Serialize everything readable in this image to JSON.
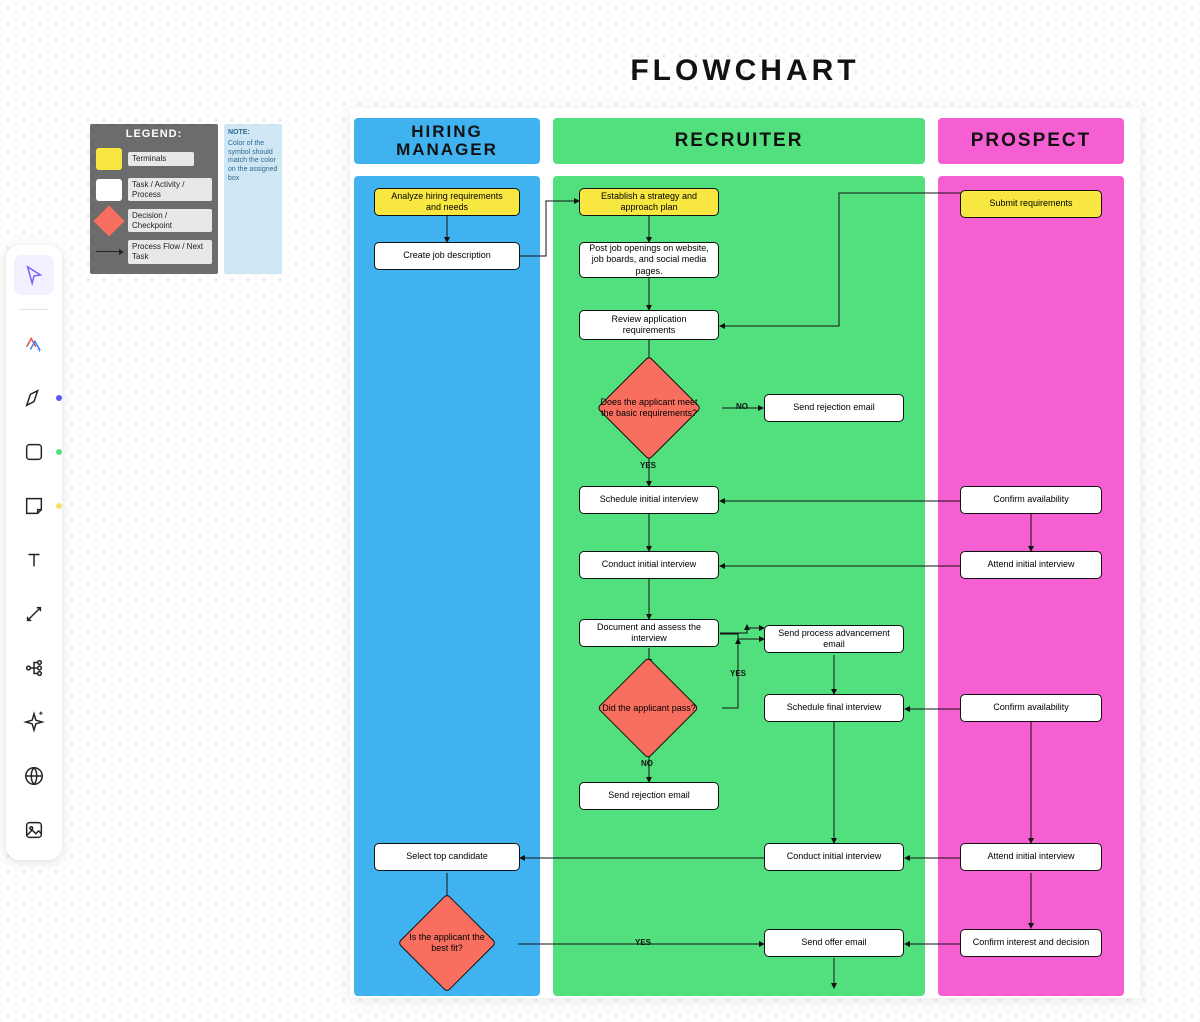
{
  "title": "FLOWCHART",
  "lanes": {
    "hiring_manager": "HIRING\nMANAGER",
    "recruiter": "RECRUITER",
    "prospect": "PROSPECT"
  },
  "legend": {
    "title": "LEGEND:",
    "terminals": "Terminals",
    "task": "Task / Activity / Process",
    "decision": "Decision / Checkpoint",
    "flow": "Process Flow / Next Task",
    "note_title": "NOTE:",
    "note_body": "Color of the symbol should match the color on the assigned box"
  },
  "nodes": {
    "hm_analyze": "Analyze hiring requirements and needs",
    "hm_create_jd": "Create job description",
    "hm_select_top": "Select top candidate",
    "hm_best_fit": "Is the applicant the best fit?",
    "r_strategy": "Establish a strategy and approach plan",
    "r_post": "Post job openings on website, job boards, and social media pages.",
    "r_review": "Review application requirements",
    "r_basic_req": "Does the applicant meet the basic requirements?",
    "r_reject1": "Send rejection email",
    "r_sched_initial": "Schedule initial interview",
    "r_conduct_initial": "Conduct initial interview",
    "r_document": "Document and assess the interview",
    "r_advance": "Send process advancement email",
    "r_sched_final": "Schedule final interview",
    "r_pass": "Did the applicant pass?",
    "r_reject2": "Send rejection email",
    "r_conduct_initial2": "Conduct initial interview",
    "r_offer": "Send offer email",
    "p_submit": "Submit requirements",
    "p_confirm1": "Confirm availability",
    "p_attend1": "Attend initial interview",
    "p_confirm2": "Confirm availability",
    "p_attend2": "Attend initial interview",
    "p_confirm_interest": "Confirm interest and decision"
  },
  "edge_labels": {
    "yes": "YES",
    "no": "NO"
  },
  "colors": {
    "lane_hm": "#3fb2ef",
    "lane_r": "#52e07e",
    "lane_p": "#f55fd1",
    "terminal": "#f8e641",
    "decision": "#f86f5f"
  },
  "toolbar": [
    {
      "name": "select-tool",
      "active": true
    },
    {
      "name": "ai-tool"
    },
    {
      "name": "pen-tool",
      "dot": "#5b57ff"
    },
    {
      "name": "shape-tool",
      "dot": "#52e07e"
    },
    {
      "name": "sticky-tool",
      "dot": "#f5e06a"
    },
    {
      "name": "text-tool"
    },
    {
      "name": "connector-tool"
    },
    {
      "name": "mindmap-tool"
    },
    {
      "name": "sparkle-tool"
    },
    {
      "name": "web-tool"
    },
    {
      "name": "image-tool"
    }
  ],
  "chart_data": {
    "type": "flowchart-swimlane",
    "title": "FLOWCHART",
    "lanes": [
      "HIRING MANAGER",
      "RECRUITER",
      "PROSPECT"
    ],
    "legend": {
      "yellow": "Terminals",
      "white": "Task / Activity / Process",
      "red_diamond": "Decision / Checkpoint",
      "arrow": "Process Flow / Next Task"
    },
    "nodes": [
      {
        "id": "hm1",
        "lane": "HIRING MANAGER",
        "type": "terminal",
        "label": "Analyze hiring requirements and needs"
      },
      {
        "id": "hm2",
        "lane": "HIRING MANAGER",
        "type": "task",
        "label": "Create job description"
      },
      {
        "id": "hm3",
        "lane": "HIRING MANAGER",
        "type": "task",
        "label": "Select top candidate"
      },
      {
        "id": "hm4",
        "lane": "HIRING MANAGER",
        "type": "decision",
        "label": "Is the applicant the best fit?"
      },
      {
        "id": "r1",
        "lane": "RECRUITER",
        "type": "terminal",
        "label": "Establish a strategy and approach plan"
      },
      {
        "id": "r2",
        "lane": "RECRUITER",
        "type": "task",
        "label": "Post job openings on website, job boards, and social media pages."
      },
      {
        "id": "r3",
        "lane": "RECRUITER",
        "type": "task",
        "label": "Review application requirements"
      },
      {
        "id": "r4",
        "lane": "RECRUITER",
        "type": "decision",
        "label": "Does the applicant meet the basic requirements?"
      },
      {
        "id": "r5",
        "lane": "RECRUITER",
        "type": "task",
        "label": "Send rejection email"
      },
      {
        "id": "r6",
        "lane": "RECRUITER",
        "type": "task",
        "label": "Schedule initial interview"
      },
      {
        "id": "r7",
        "lane": "RECRUITER",
        "type": "task",
        "label": "Conduct initial interview"
      },
      {
        "id": "r8",
        "lane": "RECRUITER",
        "type": "task",
        "label": "Document and assess the interview"
      },
      {
        "id": "r9",
        "lane": "RECRUITER",
        "type": "decision",
        "label": "Did the applicant pass?"
      },
      {
        "id": "r10",
        "lane": "RECRUITER",
        "type": "task",
        "label": "Send process advancement email"
      },
      {
        "id": "r11",
        "lane": "RECRUITER",
        "type": "task",
        "label": "Schedule final interview"
      },
      {
        "id": "r12",
        "lane": "RECRUITER",
        "type": "task",
        "label": "Send rejection email"
      },
      {
        "id": "r13",
        "lane": "RECRUITER",
        "type": "task",
        "label": "Conduct initial interview"
      },
      {
        "id": "r14",
        "lane": "RECRUITER",
        "type": "task",
        "label": "Send offer email"
      },
      {
        "id": "p1",
        "lane": "PROSPECT",
        "type": "terminal",
        "label": "Submit requirements"
      },
      {
        "id": "p2",
        "lane": "PROSPECT",
        "type": "task",
        "label": "Confirm availability"
      },
      {
        "id": "p3",
        "lane": "PROSPECT",
        "type": "task",
        "label": "Attend initial interview"
      },
      {
        "id": "p4",
        "lane": "PROSPECT",
        "type": "task",
        "label": "Confirm availability"
      },
      {
        "id": "p5",
        "lane": "PROSPECT",
        "type": "task",
        "label": "Attend initial interview"
      },
      {
        "id": "p6",
        "lane": "PROSPECT",
        "type": "task",
        "label": "Confirm interest and decision"
      }
    ],
    "edges": [
      {
        "from": "hm1",
        "to": "hm2"
      },
      {
        "from": "hm2",
        "to": "r1"
      },
      {
        "from": "r1",
        "to": "r2"
      },
      {
        "from": "r2",
        "to": "r3"
      },
      {
        "from": "p1",
        "to": "r3"
      },
      {
        "from": "r3",
        "to": "r4"
      },
      {
        "from": "r4",
        "to": "r5",
        "label": "NO"
      },
      {
        "from": "r4",
        "to": "r6",
        "label": "YES"
      },
      {
        "from": "p2",
        "to": "r6"
      },
      {
        "from": "r6",
        "to": "r7"
      },
      {
        "from": "p3",
        "to": "r7"
      },
      {
        "from": "r7",
        "to": "r8"
      },
      {
        "from": "r8",
        "to": "r9"
      },
      {
        "from": "r8",
        "to": "r10",
        "label": "YES"
      },
      {
        "from": "r10",
        "to": "r11"
      },
      {
        "from": "p4",
        "to": "r11"
      },
      {
        "from": "r9",
        "to": "r12",
        "label": "NO"
      },
      {
        "from": "r11",
        "to": "r13"
      },
      {
        "from": "p5",
        "to": "r13"
      },
      {
        "from": "r13",
        "to": "hm3"
      },
      {
        "from": "hm3",
        "to": "hm4"
      },
      {
        "from": "hm4",
        "to": "r14",
        "label": "YES"
      },
      {
        "from": "p6",
        "to": "r14"
      },
      {
        "from": "p2",
        "to": "p3"
      },
      {
        "from": "p4",
        "to": "p5"
      },
      {
        "from": "p5",
        "to": "p6"
      }
    ]
  }
}
